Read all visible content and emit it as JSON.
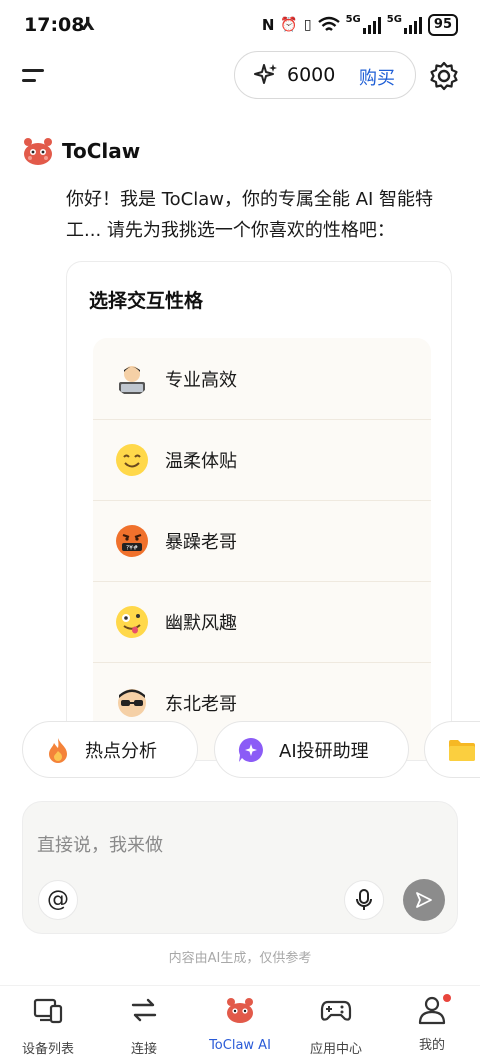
{
  "status_bar": {
    "time": "17:08",
    "network_a": "5G",
    "network_b": "5G",
    "battery": "95"
  },
  "header": {
    "credits": "6000",
    "buy_label": "购买"
  },
  "bot": {
    "name": "ToClaw"
  },
  "greeting": "你好！我是 ToClaw，你的专属全能 AI 智能特工... 请先为我挑选一个你喜欢的性格吧：",
  "personality_card": {
    "title": "选择交互性格",
    "options": [
      {
        "label": "专业高效",
        "icon": "technologist-emoji-icon"
      },
      {
        "label": "温柔体贴",
        "icon": "smiling-face-emoji-icon"
      },
      {
        "label": "暴躁老哥",
        "icon": "angry-symbols-emoji-icon"
      },
      {
        "label": "幽默风趣",
        "icon": "zany-face-emoji-icon"
      },
      {
        "label": "东北老哥",
        "icon": "sunglasses-emoji-icon"
      }
    ]
  },
  "suggestions": [
    {
      "label": "热点分析",
      "icon": "fire-icon"
    },
    {
      "label": "AI投研助理",
      "icon": "sparkle-chat-icon"
    },
    {
      "label": "",
      "icon": "folder-icon"
    }
  ],
  "composer": {
    "placeholder": "直接说，我来做"
  },
  "disclaimer": "内容由AI生成，仅供参考",
  "bottom_nav": [
    {
      "label": "设备列表",
      "icon": "devices-icon"
    },
    {
      "label": "连接",
      "icon": "swap-arrows-icon"
    },
    {
      "label": "ToClaw AI",
      "icon": "toclaw-mascot-icon",
      "active": true
    },
    {
      "label": "应用中心",
      "icon": "gamepad-icon"
    },
    {
      "label": "我的",
      "icon": "profile-icon",
      "badge": true
    }
  ],
  "colors": {
    "accent": "#2a5bd7",
    "buy": "#1f5fd6",
    "mascot": "#e25a4a",
    "badge": "#e8453c"
  }
}
